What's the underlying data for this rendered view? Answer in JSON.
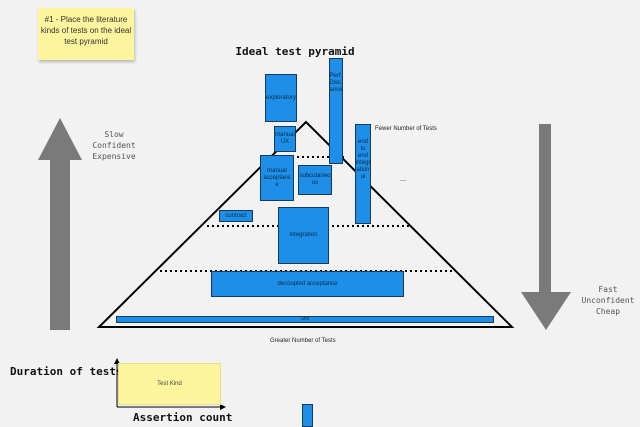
{
  "sticky_note": "#1 - Place the literature kinds of tests on the ideal test pyramid",
  "title": "Ideal test pyramid",
  "slow_label": [
    "Slow",
    "Confident",
    "Expensive"
  ],
  "fast_label": [
    "Fast",
    "Unconfident",
    "Cheap"
  ],
  "fewer_label": "Fewer Number of Tests",
  "greater_label": "Greater Number of Tests",
  "dash_mark": "—",
  "boxes": {
    "exploratory": "exploratory",
    "manual_ux": "manual UX",
    "performance": "Perf. Disc. ance",
    "manual_acceptance": "manual acceptanc e",
    "subcutaneous": "subcutaneo us",
    "end_to_end": "end to end integr ation ui",
    "contract": "contract",
    "integration": "integration",
    "decoupled_acceptance": "decoupled acceptance",
    "unit": "unit"
  },
  "chart_axes": {
    "y_label": "Duration of tests",
    "x_label": "Assertion count",
    "sticky": "Test Kind"
  },
  "colors": {
    "box_fill": "#1e8fe8",
    "sticky": "#fdf59d",
    "arrow": "#7a7a7a"
  }
}
